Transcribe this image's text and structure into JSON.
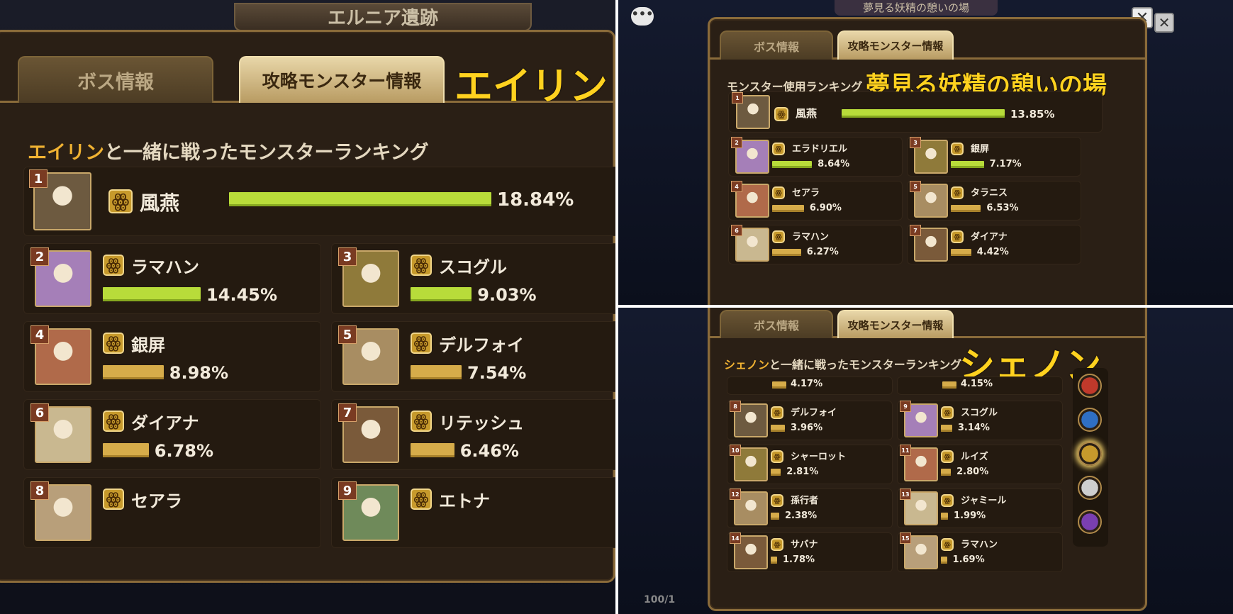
{
  "left": {
    "header_fragment": "エルニア遺跡",
    "tabs": [
      "ボス情報",
      "攻略モンスター情報"
    ],
    "boss_name": "エイリン",
    "subtitle_highlight": "エイリン",
    "subtitle_rest": "と一緒に戦ったモンスターランキング",
    "ranks": [
      {
        "rank": "1",
        "name": "風燕",
        "percent": "18.84%",
        "value": 18.84
      },
      {
        "rank": "2",
        "name": "ラマハン",
        "percent": "14.45%",
        "value": 14.45
      },
      {
        "rank": "3",
        "name": "スコグル",
        "percent": "9.03%",
        "value": 9.03
      },
      {
        "rank": "4",
        "name": "銀屏",
        "percent": "8.98%",
        "value": 8.98
      },
      {
        "rank": "5",
        "name": "デルフォイ",
        "percent": "7.54%",
        "value": 7.54
      },
      {
        "rank": "6",
        "name": "ダイアナ",
        "percent": "6.78%",
        "value": 6.78
      },
      {
        "rank": "7",
        "name": "リテッシュ",
        "percent": "6.46%",
        "value": 6.46
      },
      {
        "rank": "8",
        "name": "セアラ",
        "percent": "",
        "value": null
      },
      {
        "rank": "9",
        "name": "エトナ",
        "percent": "",
        "value": null
      }
    ]
  },
  "top_right": {
    "header_fragment": "夢見る妖精の憩いの場",
    "tabs": [
      "ボス情報",
      "攻略モンスター情報"
    ],
    "subtitle": "モンスター使用ランキング",
    "dungeon_name": "夢見る妖精の憩いの場",
    "close_label": "✕",
    "ranks": [
      {
        "rank": "1",
        "name": "風燕",
        "percent": "13.85%",
        "value": 13.85
      },
      {
        "rank": "2",
        "name": "エラドリエル",
        "percent": "8.64%",
        "value": 8.64
      },
      {
        "rank": "3",
        "name": "銀屏",
        "percent": "7.17%",
        "value": 7.17
      },
      {
        "rank": "4",
        "name": "セアラ",
        "percent": "6.90%",
        "value": 6.9
      },
      {
        "rank": "5",
        "name": "タラニス",
        "percent": "6.53%",
        "value": 6.53
      },
      {
        "rank": "6",
        "name": "ラマハン",
        "percent": "6.27%",
        "value": 6.27
      },
      {
        "rank": "7",
        "name": "ダイアナ",
        "percent": "4.42%",
        "value": 4.42
      }
    ]
  },
  "bottom_right": {
    "tabs": [
      "ボス情報",
      "攻略モンスター情報"
    ],
    "boss_name": "シェノン",
    "subtitle_highlight": "シェノン",
    "subtitle_rest": "と一緒に戦ったモンスターランキング",
    "status_text": "100/1",
    "partial_row": [
      {
        "percent": "4.17%",
        "value": 4.17
      },
      {
        "percent": "4.15%",
        "value": 4.15
      }
    ],
    "ranks": [
      {
        "rank": "8",
        "name": "デルフォイ",
        "percent": "3.96%",
        "value": 3.96
      },
      {
        "rank": "9",
        "name": "スコグル",
        "percent": "3.14%",
        "value": 3.14
      },
      {
        "rank": "10",
        "name": "シャーロット",
        "percent": "2.81%",
        "value": 2.81
      },
      {
        "rank": "11",
        "name": "ルイズ",
        "percent": "2.80%",
        "value": 2.8
      },
      {
        "rank": "12",
        "name": "孫行者",
        "percent": "2.38%",
        "value": 2.38
      },
      {
        "rank": "13",
        "name": "ジャミール",
        "percent": "1.99%",
        "value": 1.99
      },
      {
        "rank": "14",
        "name": "サバナ",
        "percent": "1.78%",
        "value": 1.78
      },
      {
        "rank": "15",
        "name": "ラマハン",
        "percent": "1.69%",
        "value": 1.69
      }
    ],
    "element_filters": [
      {
        "name": "fire",
        "color": "#c0392b"
      },
      {
        "name": "water",
        "color": "#2f6fc4"
      },
      {
        "name": "wind",
        "color": "#c79a2c"
      },
      {
        "name": "light",
        "color": "#cfcfcf"
      },
      {
        "name": "dark",
        "color": "#7a3fb0"
      }
    ]
  },
  "avatar_colors": [
    "#6d5a40",
    "#a57fb8",
    "#8f7a3a",
    "#b06a4a",
    "#a88d62",
    "#c9b890",
    "#7a5a3a",
    "#b89f7a",
    "#6f8a5a",
    "#5aa08a",
    "#c9a050",
    "#8a6a4a",
    "#4a5a3a",
    "#b08a5a",
    "#9a6a3a"
  ],
  "wind_glyph": "ꙮ"
}
